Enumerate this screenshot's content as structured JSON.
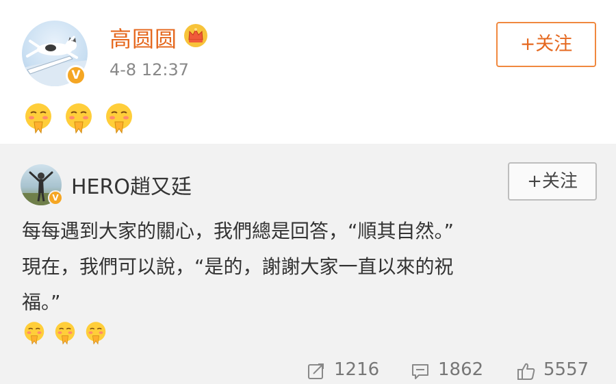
{
  "post": {
    "author": "高圆圆",
    "timestamp": "4-8 12:37",
    "follow_label": "+关注",
    "emojis": [
      "pray-face-emoji",
      "pray-face-emoji",
      "pray-face-emoji"
    ],
    "accent_color": "#e5681f"
  },
  "repost": {
    "author": "HERO趙又廷",
    "follow_label": "+关注",
    "text_lines": [
      "每每遇到大家的關心，我們總是回答，“順其自然。”",
      "現在，我們可以說，“是的，謝謝大家一直以來的祝",
      "福。”"
    ],
    "emojis": [
      "pray-face-emoji",
      "pray-face-emoji",
      "pray-face-emoji"
    ],
    "actions": {
      "repost_count": "1216",
      "comment_count": "1862",
      "like_count": "5557"
    }
  }
}
